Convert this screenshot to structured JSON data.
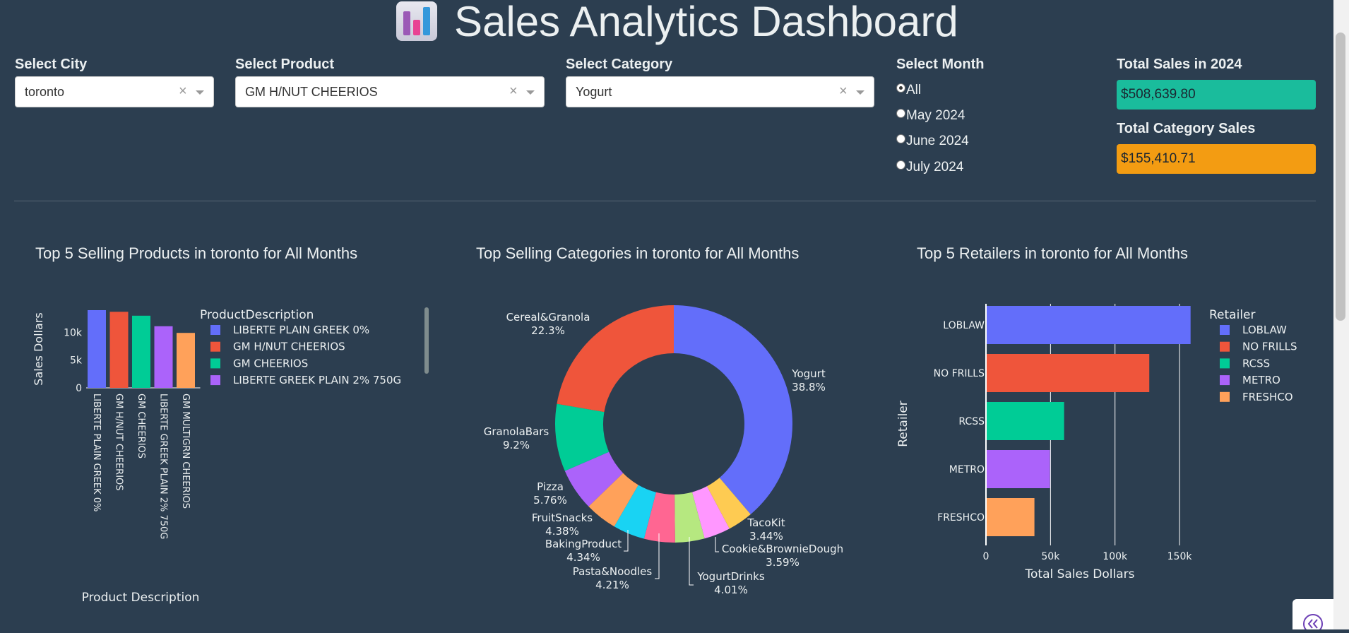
{
  "header": {
    "title": "Sales Analytics Dashboard",
    "icon": "bar-chart-icon"
  },
  "filters": {
    "city": {
      "label": "Select City",
      "value": "toronto"
    },
    "product": {
      "label": "Select Product",
      "value": "GM H/NUT CHEERIOS"
    },
    "category": {
      "label": "Select Category",
      "value": "Yogurt"
    },
    "month": {
      "label": "Select Month",
      "options": [
        "All",
        "May 2024",
        "June 2024",
        "July 2024"
      ],
      "selected": "All"
    }
  },
  "kpis": {
    "total_sales_label": "Total Sales in 2024",
    "total_sales_value": "$508,639.80",
    "total_category_label": "Total Category Sales",
    "total_category_value": "$155,410.71",
    "total_sales_color": "#1abc9c",
    "total_category_color": "#f39c12"
  },
  "chart_data": [
    {
      "type": "bar",
      "title": "Top 5 Selling Products in toronto for All Months",
      "xlabel": "Product Description",
      "ylabel": "Sales Dollars",
      "legend_title": "ProductDescription",
      "legend_placement": "right",
      "categories": [
        "LIBERTE PLAIN GREEK 0%",
        "GM H/NUT CHEERIOS",
        "GM CHEERIOS",
        "LIBERTE GREEK PLAIN 2%    750G",
        "GM MULTIGRN CHEERIOS"
      ],
      "values": [
        14000,
        13700,
        13000,
        11100,
        9900
      ],
      "colors": [
        "#636efa",
        "#ef553b",
        "#00cc96",
        "#ab63fa",
        "#ffa15a"
      ],
      "legend_entries": [
        "LIBERTE PLAIN GREEK 0%",
        "GM H/NUT CHEERIOS",
        "GM CHEERIOS",
        "LIBERTE GREEK PLAIN 2%    750G"
      ],
      "yticks": [
        "0",
        "5k",
        "10k"
      ],
      "ylim": [
        0,
        14000
      ]
    },
    {
      "type": "pie",
      "hole": true,
      "title": "Top Selling Categories in toronto for All Months",
      "slices": [
        {
          "label": "Yogurt",
          "percent": 38.8,
          "color": "#636efa"
        },
        {
          "label": "TacoKit",
          "percent": 3.44,
          "color": "#fecb52"
        },
        {
          "label": "Cookie&BrownieDough",
          "percent": 3.59,
          "color": "#ff97ff"
        },
        {
          "label": "YogurtDrinks",
          "percent": 4.01,
          "color": "#b6e880"
        },
        {
          "label": "Pasta&Noodles",
          "percent": 4.21,
          "color": "#ff6692"
        },
        {
          "label": "BakingProduct",
          "percent": 4.34,
          "color": "#19d3f3"
        },
        {
          "label": "FruitSnacks",
          "percent": 4.38,
          "color": "#ffa15a"
        },
        {
          "label": "Pizza",
          "percent": 5.76,
          "color": "#ab63fa"
        },
        {
          "label": "GranolaBars",
          "percent": 9.2,
          "color": "#00cc96"
        },
        {
          "label": "Cereal&Granola",
          "percent": 22.3,
          "color": "#ef553b"
        }
      ],
      "labels_text": {
        "Yogurt": [
          "Yogurt",
          "38.8%"
        ],
        "TacoKit": [
          "TacoKit",
          "3.44%"
        ],
        "Cookie&BrownieDough": [
          "Cookie&BrownieDough",
          "3.59%"
        ],
        "YogurtDrinks": [
          "YogurtDrinks",
          "4.01%"
        ],
        "Pasta&Noodles": [
          "Pasta&Noodles",
          "4.21%"
        ],
        "BakingProduct": [
          "BakingProduct",
          "4.34%"
        ],
        "FruitSnacks": [
          "FruitSnacks",
          "4.38%"
        ],
        "Pizza": [
          "Pizza",
          "5.76%"
        ],
        "GranolaBars": [
          "GranolaBars",
          "9.2%"
        ],
        "Cereal&Granola": [
          "Cereal&Granola",
          "22.3%"
        ]
      }
    },
    {
      "type": "bar",
      "orientation": "horizontal",
      "title": "Top 5 Retailers in toronto for All Months",
      "xlabel": "Total Sales Dollars",
      "ylabel": "Retailer",
      "legend_title": "Retailer",
      "legend_placement": "right",
      "categories": [
        "LOBLAW",
        "NO FRILLS",
        "RCSS",
        "METRO",
        "FRESHCO"
      ],
      "values": [
        158000,
        126000,
        60000,
        49000,
        37000
      ],
      "colors": [
        "#636efa",
        "#ef553b",
        "#00cc96",
        "#ab63fa",
        "#ffa15a"
      ],
      "xticks": [
        "0",
        "50k",
        "100k",
        "150k"
      ],
      "xlim": [
        0,
        162000
      ]
    }
  ]
}
